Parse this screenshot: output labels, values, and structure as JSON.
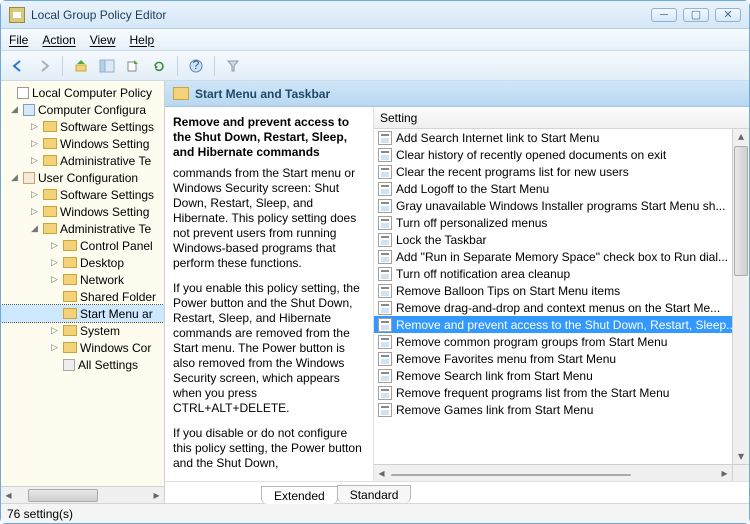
{
  "window": {
    "title": "Local Group Policy Editor"
  },
  "menu": {
    "file": "File",
    "action": "Action",
    "view": "View",
    "help": "Help"
  },
  "tree": {
    "root": "Local Computer Policy",
    "computer_config": "Computer Configura",
    "cc_software": "Software Settings",
    "cc_windows": "Windows Setting",
    "cc_admin": "Administrative Te",
    "user_config": "User Configuration",
    "uc_software": "Software Settings",
    "uc_windows": "Windows Setting",
    "uc_admin": "Administrative Te",
    "control_panel": "Control Panel",
    "desktop": "Desktop",
    "network": "Network",
    "shared_folders": "Shared Folder",
    "start_menu": "Start Menu ar",
    "system": "System",
    "windows_components": "Windows Cor",
    "all_settings": "All Settings"
  },
  "header": {
    "title": "Start Menu and Taskbar"
  },
  "desc": {
    "title": "Remove and prevent access to the Shut Down, Restart, Sleep, and Hibernate commands",
    "p1": "commands from the Start menu or Windows Security screen: Shut Down, Restart, Sleep, and Hibernate. This policy setting does not prevent users from running Windows-based programs that perform these functions.",
    "p2": "If you enable this policy setting, the Power button and the Shut Down, Restart, Sleep, and Hibernate commands are removed from the Start menu. The Power button is also removed from the Windows Security screen, which appears when you press CTRL+ALT+DELETE.",
    "p3": "If you disable or do not configure this policy setting, the Power button and the Shut Down,"
  },
  "settings_col": "Setting",
  "settings": [
    "Add Search Internet link to Start Menu",
    "Clear history of recently opened documents on exit",
    "Clear the recent programs list for new users",
    "Add Logoff to the Start Menu",
    "Gray unavailable Windows Installer programs Start Menu sh...",
    "Turn off personalized menus",
    "Lock the Taskbar",
    "Add \"Run in Separate Memory Space\" check box to Run dial...",
    "Turn off notification area cleanup",
    "Remove Balloon Tips on Start Menu items",
    "Remove drag-and-drop and context menus on the Start Me...",
    "Remove and prevent access to the Shut Down, Restart, Sleep...",
    "Remove common program groups from Start Menu",
    "Remove Favorites menu from Start Menu",
    "Remove Search link from Start Menu",
    "Remove frequent programs list from the Start Menu",
    "Remove Games link from Start Menu"
  ],
  "selected_setting_index": 11,
  "tabs": {
    "extended": "Extended",
    "standard": "Standard"
  },
  "status": "76 setting(s)"
}
